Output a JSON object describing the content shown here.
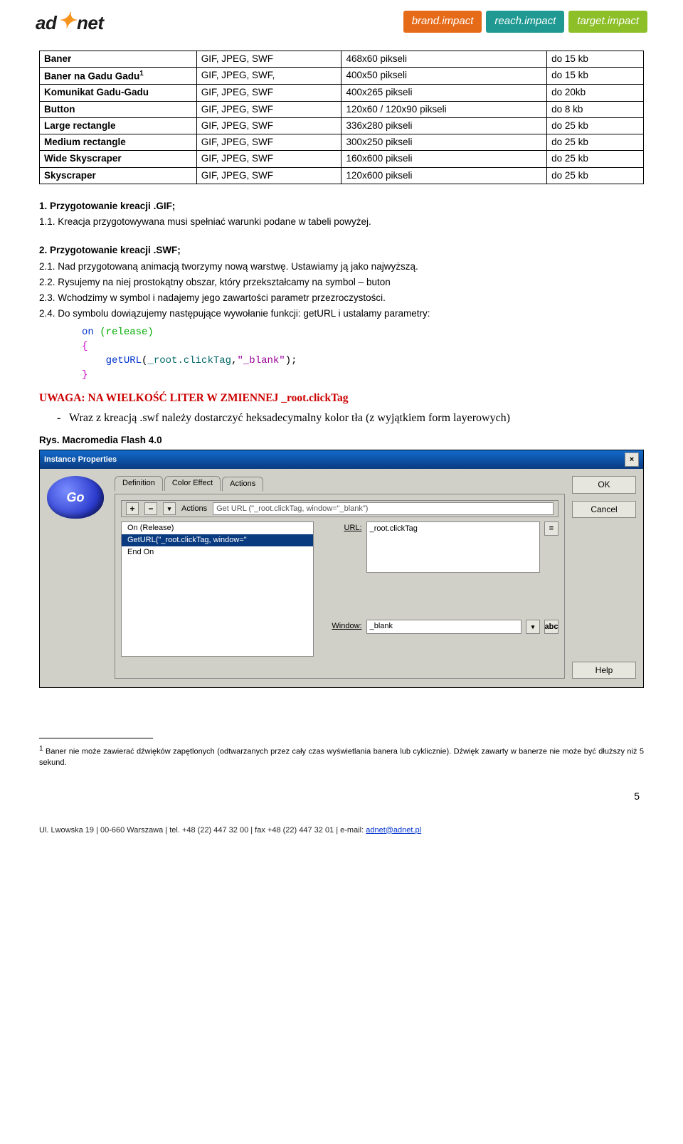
{
  "header": {
    "logo_left": "ad",
    "logo_right": "net",
    "pills": {
      "brand": "brand.impact",
      "reach": "reach.impact",
      "target": "target.impact"
    }
  },
  "table": {
    "rows": [
      {
        "name": "Baner",
        "fmt": "GIF, JPEG, SWF",
        "dim": "468x60 pikseli",
        "max": "do 15 kb"
      },
      {
        "name": "Baner na Gadu Gadu",
        "sup": "1",
        "fmt": "GIF, JPEG, SWF,",
        "dim": "400x50 pikseli",
        "max": "do 15 kb"
      },
      {
        "name": "Komunikat Gadu-Gadu",
        "fmt": "GIF, JPEG, SWF",
        "dim": "400x265 pikseli",
        "max": "do 20kb"
      },
      {
        "name": "Button",
        "fmt": "GIF, JPEG, SWF",
        "dim": "120x60 / 120x90 pikseli",
        "max": "do 8 kb"
      },
      {
        "name": "Large rectangle",
        "fmt": "GIF, JPEG, SWF",
        "dim": "336x280 pikseli",
        "max": "do 25 kb"
      },
      {
        "name": "Medium rectangle",
        "fmt": "GIF, JPEG, SWF",
        "dim": "300x250 pikseli",
        "max": "do 25 kb"
      },
      {
        "name": "Wide Skyscraper",
        "fmt": "GIF, JPEG, SWF",
        "dim": "160x600 pikseli",
        "max": "do 25 kb"
      },
      {
        "name": "Skyscraper",
        "fmt": "GIF, JPEG, SWF",
        "dim": "120x600 pikseli",
        "max": "do 25 kb"
      }
    ]
  },
  "body": {
    "s1_head": "1. Przygotowanie kreacji .GIF;",
    "s1_1": "1.1. Kreacja przygotowywana musi spełniać warunki podane w tabeli powyżej.",
    "s2_head": "2. Przygotowanie kreacji .SWF;",
    "s2_1": "2.1. Nad przygotowaną animacją tworzymy nową warstwę. Ustawiamy ją jako najwyższą.",
    "s2_2": "2.2. Rysujemy na niej prostokątny obszar, który przekształcamy na symbol – buton",
    "s2_3": "2.3. Wchodzimy w symbol i nadajemy jego zawartości parametr przezroczystości.",
    "s2_4": "2.4. Do symbolu dowiązujemy następujące wywołanie funkcji: getURL i ustalamy parametry:",
    "code_on": "on",
    "code_release": "(release)",
    "code_open": "{",
    "code_fn": "getURL",
    "code_arg1": "_root.clickTag",
    "code_argstr": "\"_blank\"",
    "code_close": "}",
    "warning": "UWAGA: NA WIELKOŚĆ LITER W ZMIENNEJ _root.clickTag",
    "note_dash": "-",
    "note": "Wraz z kreacją .swf należy dostarczyć heksadecymalny kolor tła (z wyjątkiem form layerowych)",
    "caption": "Rys. Macromedia Flash 4.0"
  },
  "flash": {
    "title": "Instance Properties",
    "tabs": {
      "def": "Definition",
      "color": "Color Effect",
      "actions": "Actions"
    },
    "go": "Go",
    "minus": "−",
    "plus": "+",
    "drop": "▾",
    "actions_label": "Actions",
    "actions_combo": "Get URL (\"_root.clickTag, window=\"_blank\")",
    "list": {
      "l1": "On (Release)",
      "l2": "GetURL(\"_root.clickTag, window=\"",
      "l3": "End On"
    },
    "url_label": "URL:",
    "url_value": "_root.clickTag",
    "win_label": "Window:",
    "win_value": "_blank",
    "abc": "abc",
    "eq": "=",
    "ok": "OK",
    "cancel": "Cancel",
    "help": "Help",
    "x": "×"
  },
  "footnote": {
    "num": "1",
    "text": "Baner nie może zawierać dźwięków zapętlonych (odtwarzanych przez cały czas wyświetlania banera lub cyklicznie). Dźwięk zawarty w banerze nie może być dłuższy niż 5 sekund."
  },
  "page_number": "5",
  "footer": {
    "addr": "Ul. Lwowska 19  |  00-660 Warszawa  |  tel. +48 (22) 447 32 00  |  fax +48 (22) 447 32 01  |  e-mail: ",
    "email": "adnet@adnet.pl"
  }
}
